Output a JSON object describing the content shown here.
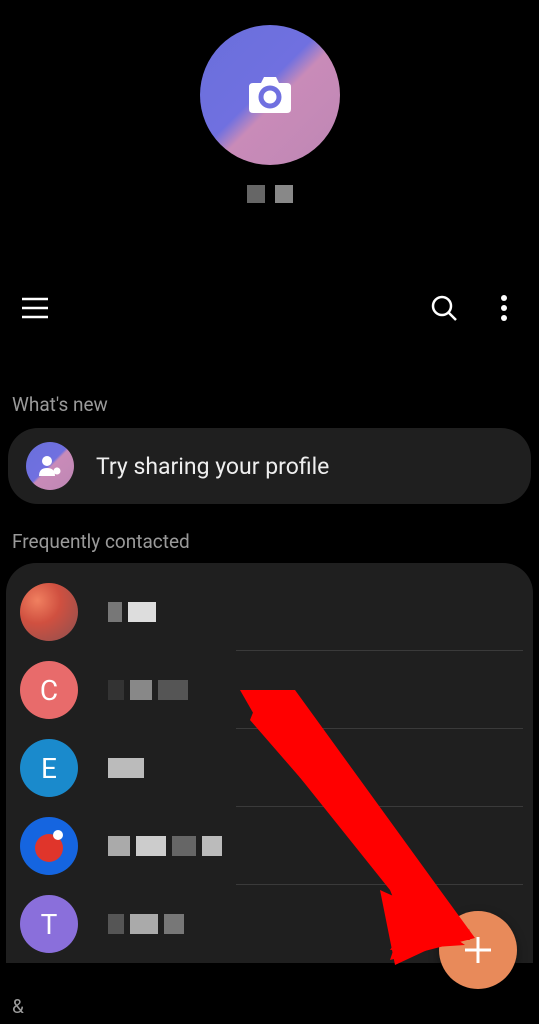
{
  "profile": {
    "icon_name": "camera-icon"
  },
  "sections": {
    "whats_new": "What's new",
    "share_profile": "Try sharing your profile",
    "freq_contacted": "Frequently contacted"
  },
  "contacts": [
    {
      "initial": "",
      "avatar_type": "image",
      "color": "#e8654a"
    },
    {
      "initial": "C",
      "avatar_type": "letter",
      "color": "#e86b6b"
    },
    {
      "initial": "E",
      "avatar_type": "letter",
      "color": "#1a8acc"
    },
    {
      "initial": "",
      "avatar_type": "pingpong",
      "color": "#1565e0"
    },
    {
      "initial": "T",
      "avatar_type": "letter",
      "color": "#8a6fdb"
    }
  ],
  "index_letter": "&"
}
